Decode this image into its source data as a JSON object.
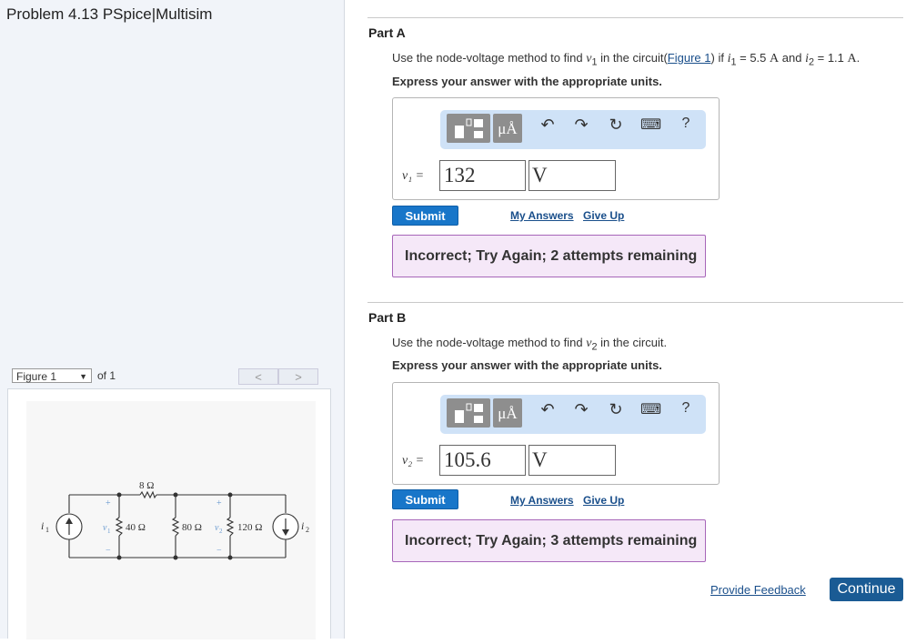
{
  "problem": {
    "title": "Problem 4.13 PSpice|Multisim"
  },
  "figure_nav": {
    "selected": "Figure 1",
    "of_label": "of 1",
    "prev": "<",
    "next": ">"
  },
  "figure": {
    "labels": {
      "r_series": "8 Ω",
      "r1": "40 Ω",
      "r2": "80 Ω",
      "r3": "120 Ω",
      "i1": "i",
      "i1_sub": "1",
      "i2": "i",
      "i2_sub": "2",
      "v1": "v",
      "v1_sub": "1",
      "v2": "v",
      "v2_sub": "2",
      "plus": "+",
      "minus": "−"
    }
  },
  "part_a": {
    "title": "Part A",
    "q_pre": "Use the node-voltage method to find",
    "q_var": "v",
    "q_var_sub": "1",
    "q_mid": "in the circuit(",
    "q_link": "Figure 1",
    "q_after": ") if",
    "q_i1": "i",
    "q_i1_sub": "1",
    "q_i1_val": " = 5.5",
    "q_unit": "A",
    "q_and": "and",
    "q_i2": "i",
    "q_i2_sub": "2",
    "q_i2_val": " = 1.1",
    "q_unit2": "A",
    "q_end": ".",
    "express": "Express your answer with the appropriate units.",
    "var_label": "v₁ =",
    "value": "132",
    "unit": "V",
    "submit": "Submit",
    "my_answers": "My Answers",
    "give_up": "Give Up",
    "feedback": "Incorrect; Try Again; 2 attempts remaining"
  },
  "part_b": {
    "title": "Part B",
    "q_pre": "Use the node-voltage method to find",
    "q_var": "v",
    "q_var_sub": "2",
    "q_post": "in the circuit.",
    "express": "Express your answer with the appropriate units.",
    "var_label": "v₂ =",
    "value": "105.6",
    "unit": "V",
    "submit": "Submit",
    "my_answers": "My Answers",
    "give_up": "Give Up",
    "feedback": "Incorrect; Try Again; 3 attempts remaining"
  },
  "toolbar": {
    "units_label": "μÅ",
    "help": "?"
  },
  "footer": {
    "provide_feedback": "Provide Feedback",
    "continue": "Continue"
  }
}
